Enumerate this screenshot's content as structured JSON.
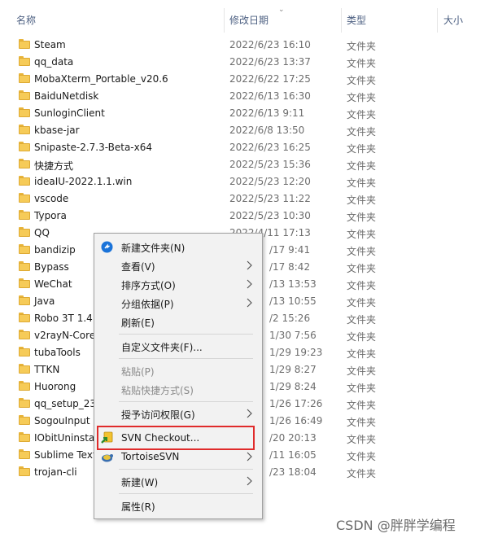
{
  "columns": {
    "name": "名称",
    "date": "修改日期",
    "type": "类型",
    "size": "大小"
  },
  "files": [
    {
      "name": "Steam",
      "date": "2022/6/23 16:10",
      "type": "文件夹"
    },
    {
      "name": "qq_data",
      "date": "2022/6/23 13:37",
      "type": "文件夹"
    },
    {
      "name": "MobaXterm_Portable_v20.6",
      "date": "2022/6/22 17:25",
      "type": "文件夹"
    },
    {
      "name": "BaiduNetdisk",
      "date": "2022/6/13 16:30",
      "type": "文件夹"
    },
    {
      "name": "SunloginClient",
      "date": "2022/6/13 9:11",
      "type": "文件夹"
    },
    {
      "name": "kbase-jar",
      "date": "2022/6/8 13:50",
      "type": "文件夹"
    },
    {
      "name": "Snipaste-2.7.3-Beta-x64",
      "date": "2022/6/23 16:25",
      "type": "文件夹"
    },
    {
      "name": "快捷方式",
      "date": "2022/5/23 15:36",
      "type": "文件夹"
    },
    {
      "name": "ideaIU-2022.1.1.win",
      "date": "2022/5/23 12:20",
      "type": "文件夹"
    },
    {
      "name": "vscode",
      "date": "2022/5/23 11:22",
      "type": "文件夹"
    },
    {
      "name": "Typora",
      "date": "2022/5/23 10:30",
      "type": "文件夹"
    },
    {
      "name": "QQ",
      "date": "2022/4/11 17:13",
      "type": "文件夹"
    },
    {
      "name": "bandizip",
      "date": "/17 9:41",
      "type": "文件夹"
    },
    {
      "name": "Bypass",
      "date": "/17 8:42",
      "type": "文件夹"
    },
    {
      "name": "WeChat",
      "date": "/13 13:53",
      "type": "文件夹"
    },
    {
      "name": "Java",
      "date": "/13 10:55",
      "type": "文件夹"
    },
    {
      "name": "Robo 3T 1.4",
      "date": "/2 15:26",
      "type": "文件夹"
    },
    {
      "name": "v2rayN-Core",
      "date": "1/30 7:56",
      "type": "文件夹"
    },
    {
      "name": "tubaTools",
      "date": "1/29 19:23",
      "type": "文件夹"
    },
    {
      "name": "TTKN",
      "date": "1/29 8:27",
      "type": "文件夹"
    },
    {
      "name": "Huorong",
      "date": "1/29 8:24",
      "type": "文件夹"
    },
    {
      "name": "qq_setup_23",
      "date": "1/26 17:26",
      "type": "文件夹"
    },
    {
      "name": "SogouInput",
      "date": "1/26 16:49",
      "type": "文件夹"
    },
    {
      "name": "IObitUninsta",
      "date": "/20 20:13",
      "type": "文件夹"
    },
    {
      "name": "Sublime Text",
      "date": "/11 16:05",
      "type": "文件夹"
    },
    {
      "name": "trojan-cli",
      "date": "/23 18:04",
      "type": "文件夹"
    }
  ],
  "context_menu": {
    "new_folder": "新建文件夹(N)",
    "view": "查看(V)",
    "sort_by": "排序方式(O)",
    "group_by": "分组依据(P)",
    "refresh": "刷新(E)",
    "customize_folder": "自定义文件夹(F)...",
    "paste": "粘贴(P)",
    "paste_shortcut": "粘贴快捷方式(S)",
    "grant_access": "授予访问权限(G)",
    "svn_checkout": "SVN Checkout...",
    "tortoise_svn": "TortoiseSVN",
    "new": "新建(W)",
    "properties": "属性(R)"
  },
  "watermark": "CSDN @胖胖学编程",
  "colors": {
    "highlight_border": "#e02b2b",
    "folder_fill": "#f6cb58",
    "menu_bg": "#f2f2f2"
  }
}
